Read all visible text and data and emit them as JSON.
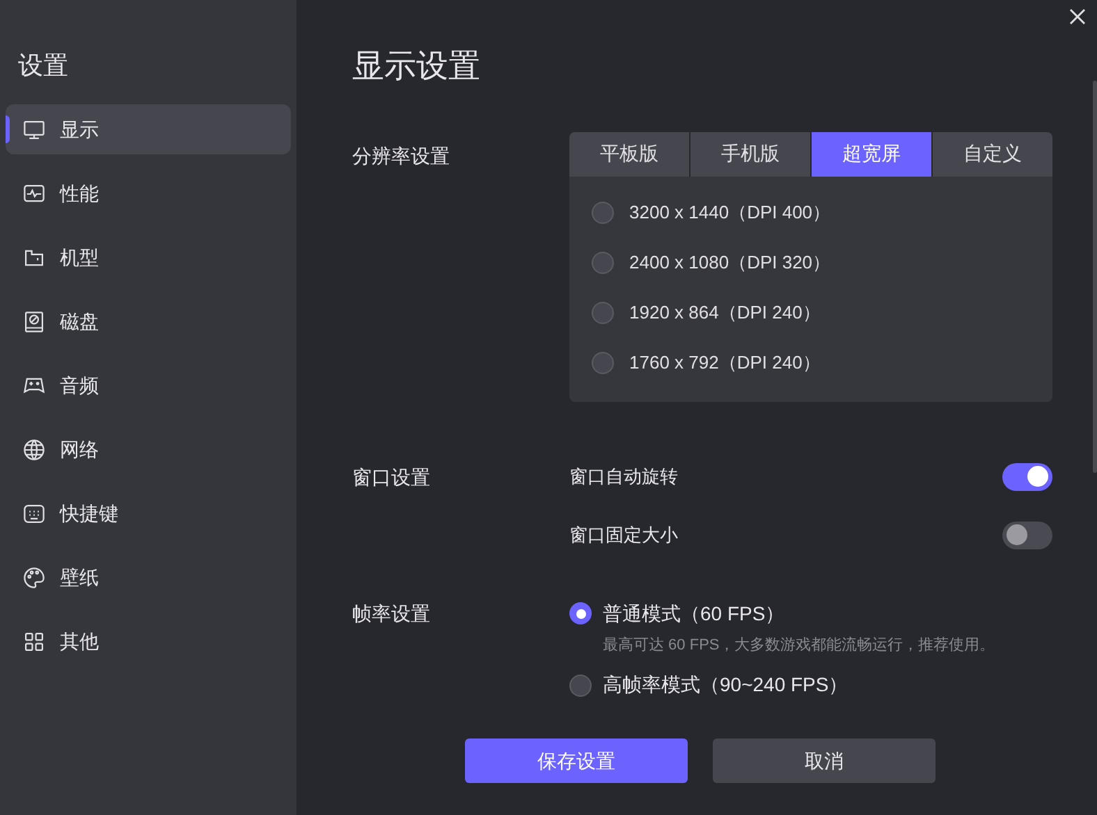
{
  "sidebar": {
    "title": "设置",
    "items": [
      {
        "label": "显示",
        "selected": true
      },
      {
        "label": "性能",
        "selected": false
      },
      {
        "label": "机型",
        "selected": false
      },
      {
        "label": "磁盘",
        "selected": false
      },
      {
        "label": "音频",
        "selected": false
      },
      {
        "label": "网络",
        "selected": false
      },
      {
        "label": "快捷键",
        "selected": false
      },
      {
        "label": "壁纸",
        "selected": false
      },
      {
        "label": "其他",
        "selected": false
      }
    ]
  },
  "page_title": "显示设置",
  "resolution": {
    "label": "分辨率设置",
    "tabs": [
      {
        "label": "平板版",
        "selected": false
      },
      {
        "label": "手机版",
        "selected": false
      },
      {
        "label": "超宽屏",
        "selected": true
      },
      {
        "label": "自定义",
        "selected": false
      }
    ],
    "options": [
      {
        "label": "3200 x 1440（DPI 400）",
        "selected": false
      },
      {
        "label": "2400 x 1080（DPI 320）",
        "selected": false
      },
      {
        "label": "1920 x 864（DPI 240）",
        "selected": false
      },
      {
        "label": "1760 x 792（DPI 240）",
        "selected": false
      }
    ]
  },
  "window": {
    "label": "窗口设置",
    "toggles": [
      {
        "label": "窗口自动旋转",
        "on": true
      },
      {
        "label": "窗口固定大小",
        "on": false
      }
    ]
  },
  "framerate": {
    "label": "帧率设置",
    "options": [
      {
        "label": "普通模式（60 FPS）",
        "description": "最高可达 60 FPS，大多数游戏都能流畅运行，推荐使用。",
        "selected": true
      },
      {
        "label": "高帧率模式（90~240 FPS）",
        "selected": false
      }
    ]
  },
  "buttons": [
    {
      "label": "保存设置",
      "kind": "primary"
    },
    {
      "label": "取消",
      "kind": "secondary"
    }
  ]
}
